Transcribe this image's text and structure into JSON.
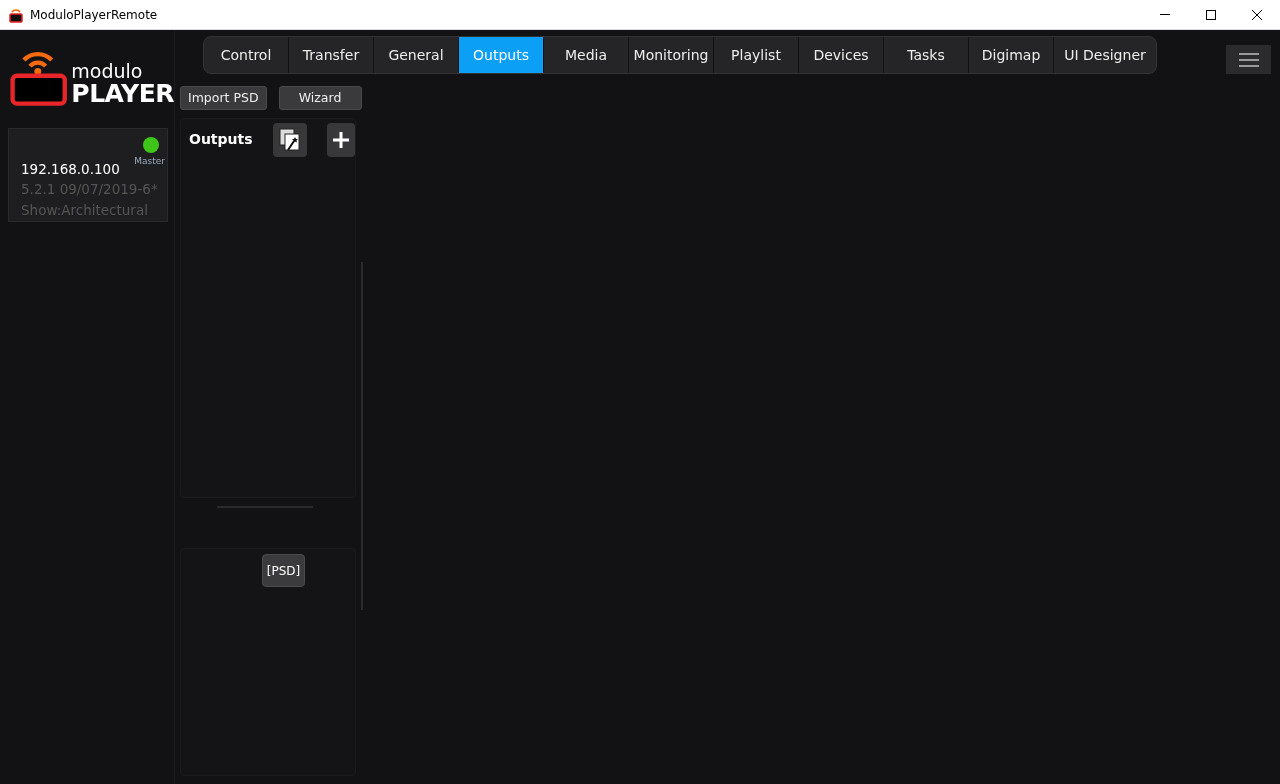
{
  "window": {
    "title": "ModuloPlayerRemote"
  },
  "logo": {
    "line_1": "modulo",
    "line_2": "PLAYER"
  },
  "tabs": [
    {
      "label": "Control",
      "selected": false
    },
    {
      "label": "Transfer",
      "selected": false
    },
    {
      "label": "General",
      "selected": false
    },
    {
      "label": "Outputs",
      "selected": true
    },
    {
      "label": "Media",
      "selected": false
    },
    {
      "label": "Monitoring",
      "selected": false
    },
    {
      "label": "Playlist",
      "selected": false
    },
    {
      "label": "Devices",
      "selected": false
    },
    {
      "label": "Tasks",
      "selected": false
    },
    {
      "label": "Digimap",
      "selected": false
    },
    {
      "label": "UI Designer",
      "selected": false
    }
  ],
  "toolbar": [
    "Import PSD",
    "Wizard"
  ],
  "device": {
    "ip": "192.168.0.100",
    "version": "5.2.1 09/07/2019-6*",
    "show": "Show:Architectural",
    "role": "Master",
    "online": true
  },
  "outputs_panel": {
    "title": "Outputs"
  },
  "psd_panel": {
    "label": "[PSD]"
  }
}
